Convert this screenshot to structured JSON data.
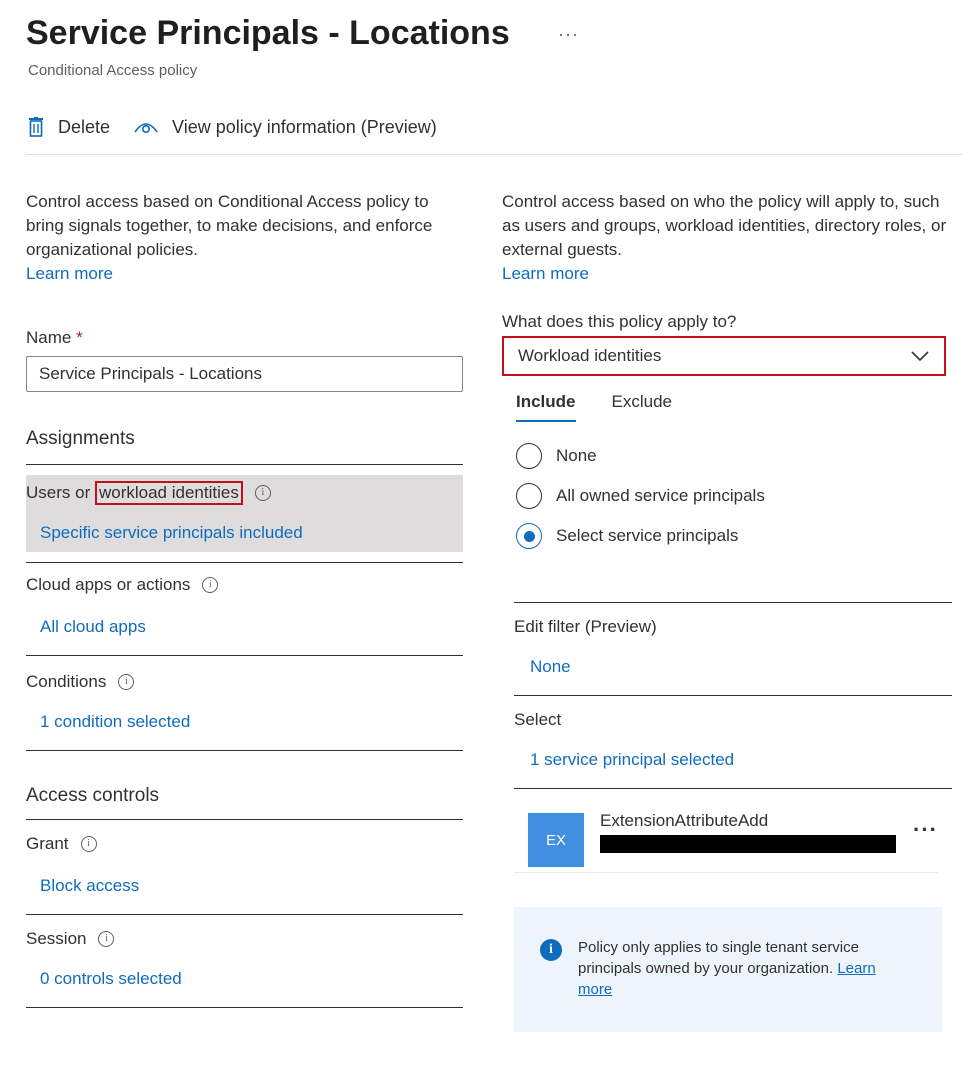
{
  "header": {
    "title": "Service Principals - Locations",
    "more": "···",
    "subtitle": "Conditional Access policy"
  },
  "toolbar": {
    "delete_label": "Delete",
    "view_info_label": "View policy information (Preview)"
  },
  "left": {
    "description": "Control access based on Conditional Access policy to bring signals together, to make decisions, and enforce organizational policies.",
    "learn_more": "Learn more",
    "name_label": "Name",
    "required_mark": "*",
    "name_value": "Service Principals - Locations",
    "assignments_title": "Assignments",
    "users_prefix": "Users or ",
    "users_highlight": "workload identities",
    "users_value": "Specific service principals included",
    "cloud_apps_label": "Cloud apps or actions",
    "cloud_apps_value": "All cloud apps",
    "conditions_label": "Conditions",
    "conditions_value": "1 condition selected",
    "access_controls_title": "Access controls",
    "grant_label": "Grant",
    "grant_value": "Block access",
    "session_label": "Session",
    "session_value": "0 controls selected"
  },
  "right": {
    "description": "Control access based on who the policy will apply to, such as users and groups, workload identities, directory roles, or external guests.",
    "learn_more": "Learn more",
    "apply_label": "What does this policy apply to?",
    "apply_value": "Workload identities",
    "tabs": [
      {
        "label": "Include"
      },
      {
        "label": "Exclude"
      }
    ],
    "radios": [
      {
        "label": "None"
      },
      {
        "label": "All owned service principals"
      },
      {
        "label": "Select service principals"
      }
    ],
    "edit_filter_label": "Edit filter (Preview)",
    "edit_filter_value": "None",
    "select_label": "Select",
    "select_value": "1 service principal selected",
    "sp_initials": "EX",
    "sp_name": "ExtensionAttributeAdd",
    "sp_more": "···",
    "info_text": "Policy only applies to single tenant service principals owned by your organization.",
    "info_link": "Learn more"
  },
  "colors": {
    "accent": "#0f6cbd",
    "highlight_border": "#c50f1f",
    "avatar": "#4190e0",
    "info_bar": "#eef4fb"
  },
  "icons": [
    "delete-icon",
    "eye-icon",
    "info-icon",
    "chevron-down-icon",
    "more-icon"
  ]
}
